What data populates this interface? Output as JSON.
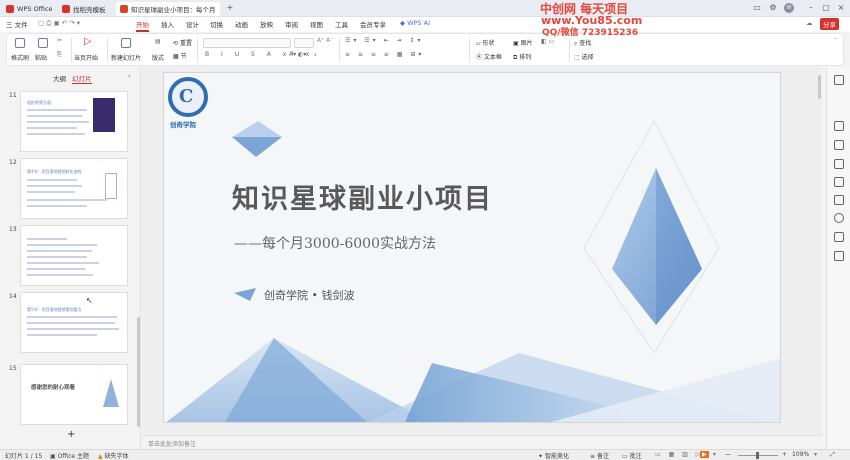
{
  "titlebar": {
    "tabs": [
      {
        "label": "WPS Office",
        "color": "#d7312d"
      },
      {
        "label": "找稻壳模板",
        "color": "#d7312d"
      },
      {
        "label": "知识星球副业小项目：每个月",
        "color": "#d24726"
      }
    ],
    "new_tab": "+"
  },
  "watermark": {
    "line1": "中创网 每天项目",
    "line2": "www.You85.com",
    "line3": "QQ/微信 723915236"
  },
  "menubar": {
    "file": "三 文件",
    "items": [
      "开始",
      "插入",
      "设计",
      "切换",
      "动画",
      "放映",
      "审阅",
      "视图",
      "工具",
      "会员专享"
    ],
    "wps_ai": "WPS AI",
    "share": "分享"
  },
  "ribbon": {
    "format_painter": "格式刷",
    "paste": "粘贴",
    "from_start": "当页开始",
    "new_slide": "新建幻灯片",
    "layout": "版式",
    "reset": "重置",
    "section": "节",
    "shape": "形状",
    "image": "图片",
    "find": "查找",
    "textbox": "文本框",
    "arrange": "排列",
    "select": "选择"
  },
  "leftpane": {
    "tab_outline": "大纲",
    "tab_slides": "幻灯片",
    "add": "+",
    "thumbs": [
      {
        "num": "11",
        "heading": "组织考察方面："
      },
      {
        "num": "12",
        "heading": "第4节：项目落地营销转化流程"
      },
      {
        "num": "13",
        "heading": ""
      },
      {
        "num": "14",
        "heading": "第5节：项目落地营销策划要点"
      },
      {
        "num": "15",
        "heading": "感谢您的耐心观看"
      }
    ]
  },
  "slide": {
    "logo_text": "创奇学院",
    "title": "知识星球副业小项目",
    "subtitle": "——每个月3000-6000实战方法",
    "author": "创奇学院 • 钱剑波",
    "notes_placeholder": "单击此处添加备注"
  },
  "statusbar": {
    "page": "幻灯片 1 / 15",
    "theme": "Office 主题",
    "font_missing": "缺失字体",
    "smart_beautify": "智能美化",
    "notes": "备注",
    "comment": "批注",
    "zoom": "109%"
  },
  "colors": {
    "accent": "#c3332b",
    "slide_blue": "#6f9fd3",
    "title_gray": "#595959"
  }
}
